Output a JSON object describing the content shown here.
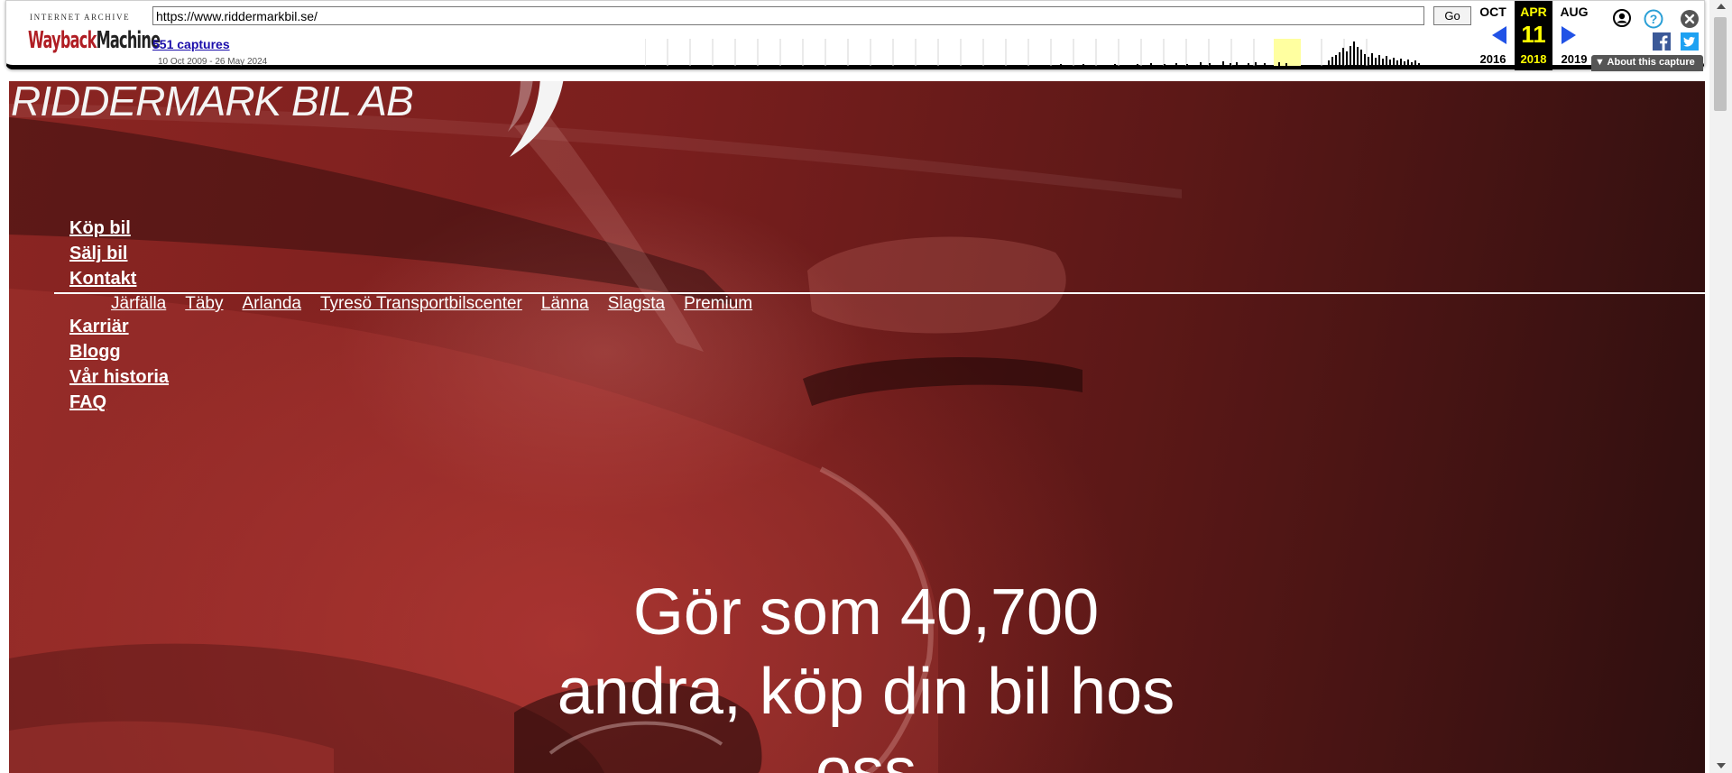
{
  "wayback": {
    "logo_top": "INTERNET ARCHIVE",
    "logo_word_way": "Wayback",
    "logo_word_machine": "Machine",
    "url_value": "https://www.riddermarkbil.se/",
    "go_label": "Go",
    "captures_label": "551 captures",
    "date_range": "10 Oct 2009 - 26 May 2024",
    "prev_month": "OCT",
    "prev_year": "2016",
    "current_month": "APR",
    "current_day": "11",
    "current_year": "2018",
    "next_month": "AUG",
    "next_year": "2019",
    "about_label": "About this capture",
    "accent_color": "#2152e6",
    "highlight_color": "#ffff00",
    "icons": [
      "user-icon",
      "help-icon",
      "close-icon",
      "facebook-icon",
      "twitter-icon",
      "prev-arrow-icon",
      "next-arrow-icon",
      "caret-down-icon"
    ]
  },
  "site": {
    "logo_text": "RIDDERMARK BIL AB",
    "nav": [
      "Köp bil",
      "Sälj bil",
      "Kontakt",
      "Karriär",
      "Blogg",
      "Vår historia",
      "FAQ"
    ],
    "sub_nav": [
      "Järfälla",
      "Täby",
      "Arlanda",
      "Tyresö Transportbilscenter",
      "Länna",
      "Slagsta",
      "Premium"
    ],
    "hero_line_1": "Gör som 40,700",
    "hero_line_2": "andra, köp din bil hos",
    "hero_line_3": "oss",
    "brand_color": "#7b1f1e"
  }
}
